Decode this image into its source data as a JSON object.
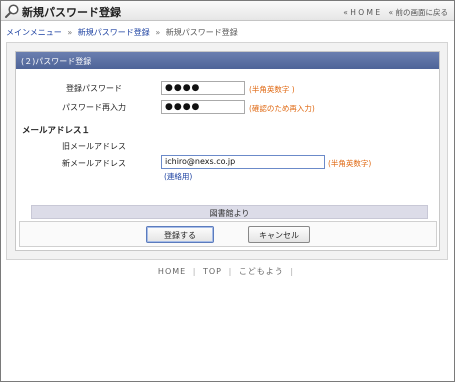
{
  "window": {
    "title": "新規パスワード登録",
    "top_links": [
      {
        "label": "« H O M E"
      },
      {
        "label": "« 前の画面に戻る"
      }
    ]
  },
  "breadcrumb": {
    "items": [
      "メインメニュー",
      "新規パスワード登録"
    ],
    "current": "新規パスワード登録",
    "separator": "»"
  },
  "section": {
    "title": "(２)パスワード登録"
  },
  "form": {
    "password_label": "登録パスワード",
    "password_value": "●●●●",
    "password_note": "(半角英数字 )",
    "password_confirm_label": "パスワード再入力",
    "password_confirm_value": "●●●●",
    "password_confirm_note": "(確認のため再入力)",
    "email_heading": "メールアドレス１",
    "old_email_label": "旧メールアドレス",
    "new_email_label": "新メールアドレス",
    "new_email_value": "ichiro@nexs.co.jp",
    "new_email_note": "(半角英数字)",
    "new_email_subnote": "(連絡用)"
  },
  "library_bar": {
    "label": "図書館より"
  },
  "buttons": {
    "register_label": "登録する",
    "cancel_label": "キャンセル"
  },
  "footer": {
    "links": [
      "HOME",
      "TOP",
      "こどもよう"
    ]
  },
  "colors": {
    "section_header": "#5a6fa3",
    "note_orange": "#e06a14",
    "link_blue": "#1a3fa0",
    "library_bar": "#dcdce8"
  }
}
